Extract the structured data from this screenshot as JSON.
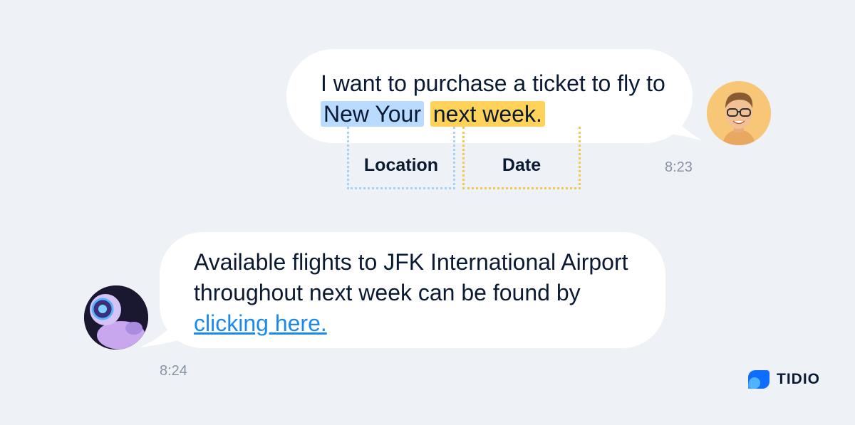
{
  "user_message": {
    "text_before": "I want to purchase a ticket to fly to ",
    "location_highlight": "New Your",
    "date_highlight": "next week.",
    "timestamp": "8:23",
    "avatar_icon": "user-avatar"
  },
  "entities": {
    "location_label": "Location",
    "date_label": "Date"
  },
  "bot_message": {
    "text_before": "Available flights to JFK International Airport throughout next week can be found by ",
    "link_text": "clicking here.",
    "timestamp": "8:24",
    "avatar_icon": "bot-avatar"
  },
  "brand": {
    "name": "TIDIO",
    "icon": "tidio-logo-icon"
  },
  "colors": {
    "background": "#eef1f6",
    "bubble": "#ffffff",
    "location_highlight": "#b8dbff",
    "date_highlight": "#ffd35a",
    "link": "#1b8aec",
    "brand_blue": "#0d6efd"
  }
}
